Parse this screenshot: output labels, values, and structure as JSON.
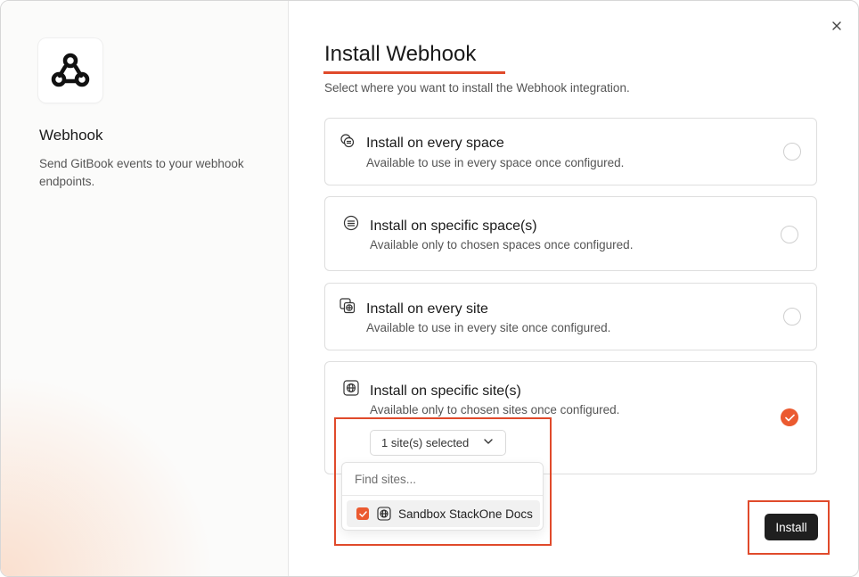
{
  "app": {
    "name": "Webhook",
    "description": "Send GitBook events to your webhook endpoints."
  },
  "dialog": {
    "title": "Install Webhook",
    "subtitle": "Select where you want to install the Webhook integration.",
    "close_icon": "close-icon"
  },
  "options": [
    {
      "title": "Install on every space",
      "description": "Available to use in every space once configured.",
      "icon": "spaces-icon",
      "selected": false
    },
    {
      "title": "Install on specific space(s)",
      "description": "Available only to chosen spaces once configured.",
      "icon": "space-icon",
      "selected": false
    },
    {
      "title": "Install on every site",
      "description": "Available to use in every site once configured.",
      "icon": "sites-icon",
      "selected": false
    },
    {
      "title": "Install on specific site(s)",
      "description": "Available only to chosen sites once configured.",
      "icon": "globe-icon",
      "selected": true
    }
  ],
  "site_select": {
    "label": "1 site(s) selected",
    "search_placeholder": "Find sites...",
    "items": [
      {
        "label": "Sandbox StackOne Docs",
        "checked": true
      }
    ]
  },
  "footer": {
    "install_label": "Install"
  },
  "colors": {
    "accent": "#eb5a30",
    "highlight": "#e04a2b",
    "primary_button": "#1f1f1f"
  }
}
